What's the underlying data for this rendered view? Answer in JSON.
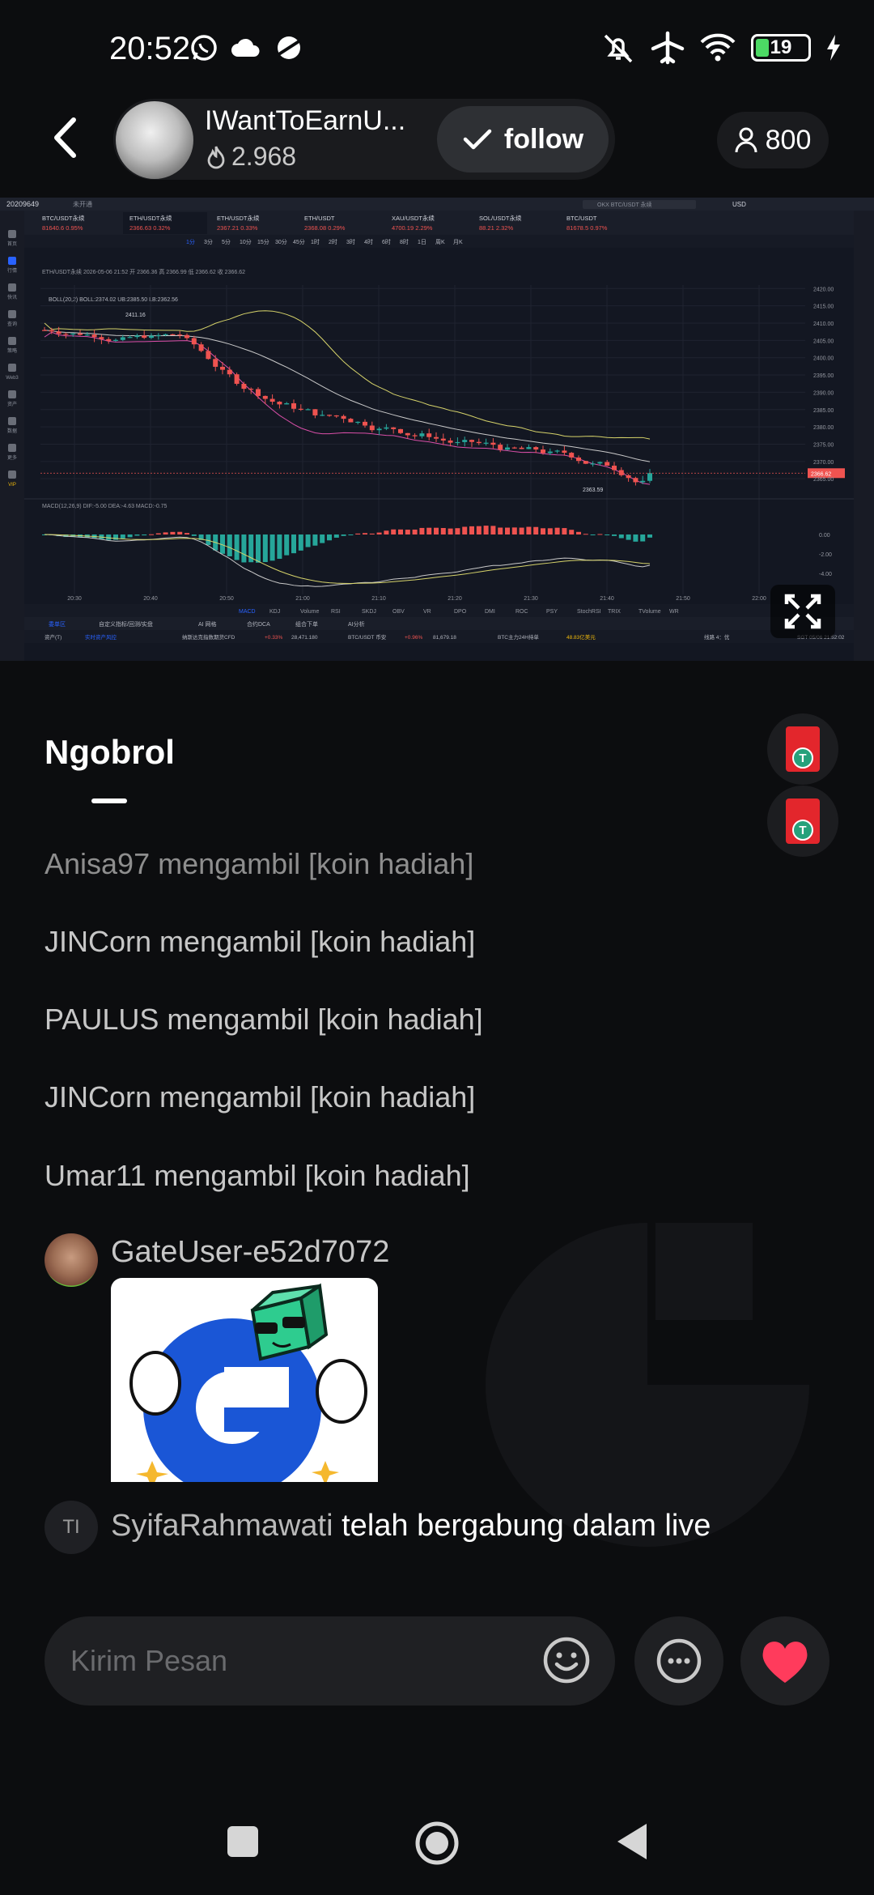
{
  "status_bar": {
    "time": "20:52",
    "battery": "19",
    "icons": [
      "whatsapp-icon",
      "cloud-icon",
      "planet-icon",
      "mute-icon",
      "airplane-icon",
      "wifi-icon",
      "battery-icon",
      "charging-icon"
    ]
  },
  "header": {
    "host_name": "IWantToEarnU...",
    "host_popularity": "2.968",
    "follow_label": "follow",
    "viewer_count": "800"
  },
  "stream": {
    "account_id": "20209649",
    "account_tag": "未开通",
    "search_placeholder": "OKX BTC/USDT 永续",
    "currency": "USD",
    "tabs": [
      {
        "name": "BTC/USDT永续",
        "price": "81640.6",
        "change": "0.95%"
      },
      {
        "name": "ETH/USDT永续",
        "price": "2366.63",
        "change": "0.32%"
      },
      {
        "name": "ETH/USDT永续",
        "price": "2367.21",
        "change": "0.33%"
      },
      {
        "name": "ETH/USDT",
        "price": "2368.08",
        "change": "0.29%"
      },
      {
        "name": "XAU/USDT永续",
        "price": "4700.19",
        "change": "2.29%"
      },
      {
        "name": "SOL/USDT永续",
        "price": "88.21",
        "change": "2.32%"
      },
      {
        "name": "BTC/USDT",
        "price": "81678.5",
        "change": "0.97%"
      }
    ],
    "timeframes": [
      "1分",
      "3分",
      "5分",
      "10分",
      "15分",
      "30分",
      "45分",
      "1时",
      "2时",
      "3时",
      "4时",
      "6时",
      "8时",
      "1日",
      "周K",
      "月K"
    ],
    "indicator_legend": "BOLL(20,2) BOLL:2374.02 UB:2385.50 LB:2362.56",
    "ohlc_line": "ETH/USDT永续 2026-05-06 21:52 开 2366.36 高 2366.99 低 2366.62 收 2366.62",
    "price_axis": [
      "2420.00",
      "2415.00",
      "2410.00",
      "2405.00",
      "2400.00",
      "2395.00",
      "2390.00",
      "2385.00",
      "2380.00",
      "2375.00",
      "2370.00",
      "2365.00"
    ],
    "current_price": "2366.62",
    "high_marker": "2411.16",
    "low_marker": "2363.59",
    "macd_legend": "MACD(12,26,9)  DIF:-5.00  DEA:-4.63  MACD:-0.75",
    "macd_axis": [
      "0.00",
      "-2.00",
      "-4.00"
    ],
    "time_axis": [
      "20:30",
      "20:40",
      "20:50",
      "21:00",
      "21:10",
      "21:20",
      "21:30",
      "21:40",
      "21:50",
      "22:00"
    ],
    "indicator_tabs": [
      "MACD",
      "KDJ",
      "Volume",
      "RSI",
      "SKDJ",
      "OBV",
      "VR",
      "DPO",
      "DMI",
      "ROC",
      "PSY",
      "StochRSI",
      "TRIX",
      "TVolume",
      "WR"
    ],
    "bottom_tabs": [
      "委单区",
      "自定义指标/回测/实盘",
      "AI 网格",
      "合约DCA",
      "组合下单",
      "AI分析"
    ],
    "footer_items": [
      "资产(T)",
      "实时资产风控",
      "纳斯达克指数期货CFD",
      "+0.33%",
      "28,471.180",
      "BTC/USDT 币安",
      "+0.96%",
      "81,679.18",
      "BTC主力24H持单",
      "48.83亿美元",
      "线路 4：优",
      "SGT 05/06 21:52:02"
    ],
    "left_sidebar": [
      "首页",
      "行情",
      "快讯",
      "查询",
      "策略",
      "Web3",
      "资产",
      "数据",
      "更多",
      "VIP"
    ]
  },
  "chart_data": {
    "type": "candlestick",
    "title": "ETH/USDT永续",
    "x_range": [
      "20:30",
      "22:00"
    ],
    "ylim": [
      2360,
      2420
    ],
    "series": [
      {
        "name": "BOLL UB",
        "value": 2385.5
      },
      {
        "name": "BOLL",
        "value": 2374.02
      },
      {
        "name": "BOLL LB",
        "value": 2362.56
      }
    ],
    "high": 2411.16,
    "low": 2363.59,
    "last": 2366.62,
    "macd": {
      "dif": -5.0,
      "dea": -4.63,
      "macd": -0.75
    }
  },
  "chat": {
    "title": "Ngobrol",
    "messages": [
      "Anisa97 mengambil [koin hadiah]",
      "JINCorn mengambil [koin hadiah]",
      "PAULUS mengambil [koin hadiah]",
      "JINCorn mengambil [koin hadiah]",
      "Umar11 mengambil [koin hadiah]"
    ],
    "sticker_user": "GateUser-e52d7072",
    "join_initials": "TI",
    "join_user": "SyifaRahmawati",
    "join_text": "telah bergabung dalam live"
  },
  "input": {
    "placeholder": "Kirim Pesan"
  },
  "colors": {
    "up": "#26a69a",
    "down": "#ef5350",
    "like": "#ff3b5c",
    "background": "#0c0d0f"
  }
}
